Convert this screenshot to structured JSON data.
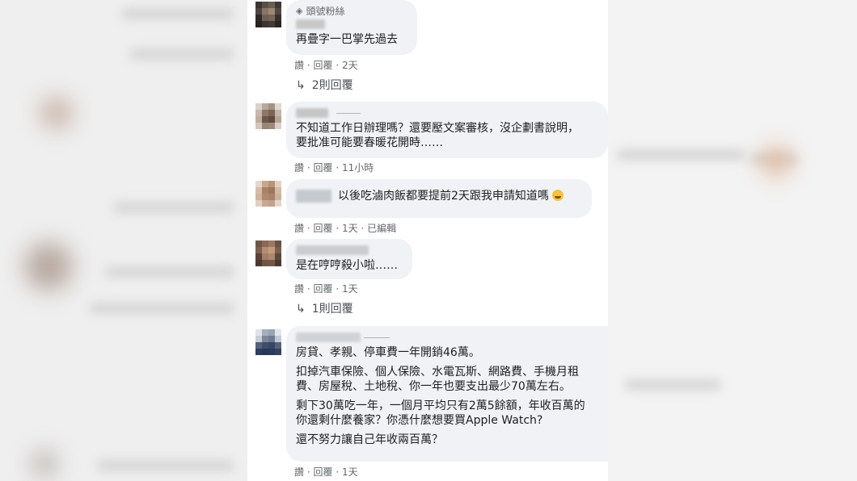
{
  "comments": [
    {
      "badge": "頭號粉絲",
      "text": [
        "再疊字一巴掌先過去"
      ],
      "actions": {
        "like": "讚",
        "reply": "回覆",
        "time": "2天"
      },
      "replies": "2則回覆"
    },
    {
      "text": [
        "不知道工作日辦理嗎？還要壓文案審核，沒企劃書說明，",
        "要批准可能要春暖花開時……"
      ],
      "actions": {
        "like": "讚",
        "reply": "回覆",
        "time": "11小時"
      }
    },
    {
      "text": [
        "以後吃滷肉飯都要提前2天跟我申請知道嗎"
      ],
      "emoji": "rolling-on-floor-laughing-emoji",
      "actions": {
        "like": "讚",
        "reply": "回覆",
        "time": "1天",
        "edited": "已編輯"
      }
    },
    {
      "text": [
        "是在哼哼殺小啦……"
      ],
      "actions": {
        "like": "讚",
        "reply": "回覆",
        "time": "1天"
      },
      "replies": "1則回覆"
    },
    {
      "paragraphs": [
        [
          "房貸、孝親、停車費一年開銷46萬。"
        ],
        [
          "扣掉汽車保險、個人保險、水電瓦斯、網路費、手機月租",
          "費、房屋稅、土地稅、你一年也要支出最少70萬左右。"
        ],
        [
          "剩下30萬吃一年，一個月平均只有2萬5餘額，年收百萬的",
          "你還剩什麼養家？你憑什麼想要買Apple Watch?"
        ],
        [
          "還不努力讓自己年收兩百萬？"
        ]
      ],
      "actions": {
        "like": "讚",
        "reply": "回覆",
        "time": "1天"
      }
    }
  ],
  "separator": "·",
  "colors": {
    "bubble": "#f0f2f5",
    "meta": "#65676b",
    "text": "#1c1e21"
  }
}
